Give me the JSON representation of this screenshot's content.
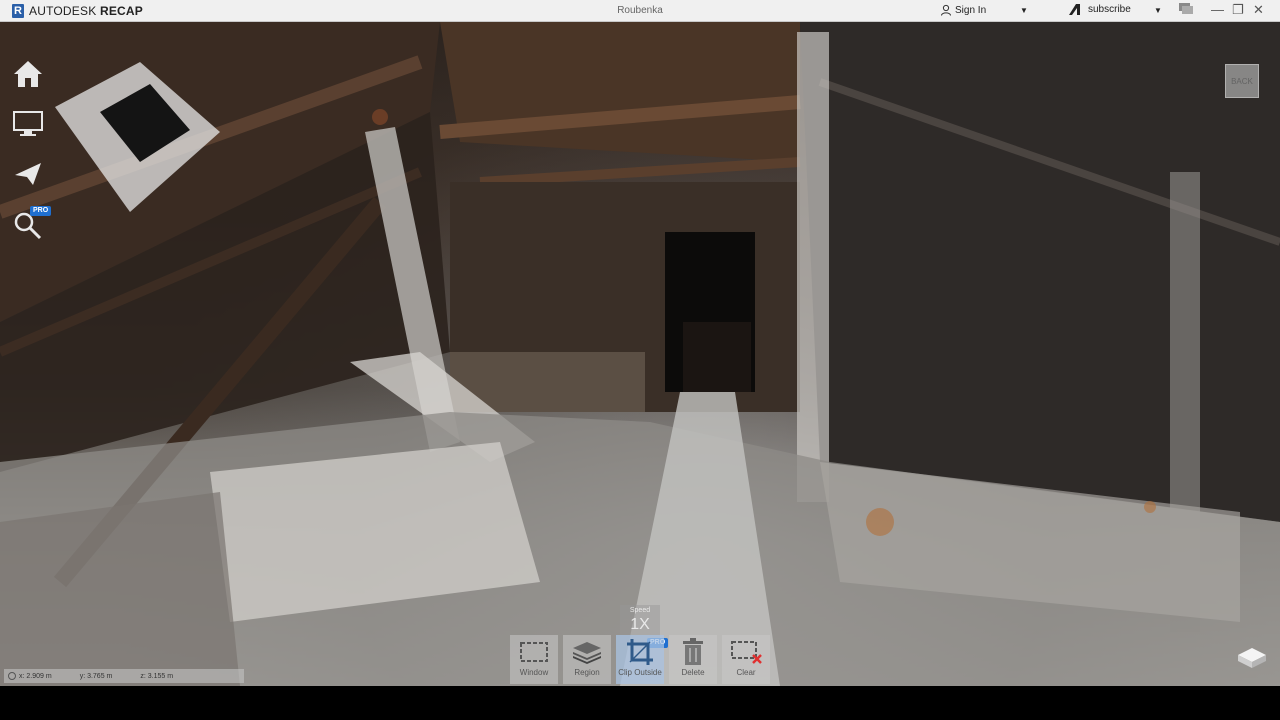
{
  "app": {
    "brand_prefix": "AUTODESK",
    "brand_name": "RECAP",
    "document_title": "Roubenka"
  },
  "account": {
    "signin_label": "Sign In",
    "subscribe_label": "subscribe"
  },
  "left_tools": {
    "home_label": "home",
    "zoom_label": "Zoom",
    "pro_badge": "PRO"
  },
  "back_label": "BACK",
  "speed": {
    "label": "Speed",
    "value": "1X"
  },
  "toolbar": {
    "pro_badge": "PRO",
    "items": [
      {
        "label": "Window"
      },
      {
        "label": "Region"
      },
      {
        "label": "Clip Outside"
      },
      {
        "label": "Delete"
      },
      {
        "label": "Clear"
      }
    ]
  },
  "coordinates": {
    "x": "x: 2.909 m",
    "y": "y: 3.765 m",
    "z": "z: 3.155 m"
  },
  "colors": {
    "brand": "#2a5fa8",
    "pro_badge": "#1f6fd0",
    "clear_x": "#e03030"
  }
}
